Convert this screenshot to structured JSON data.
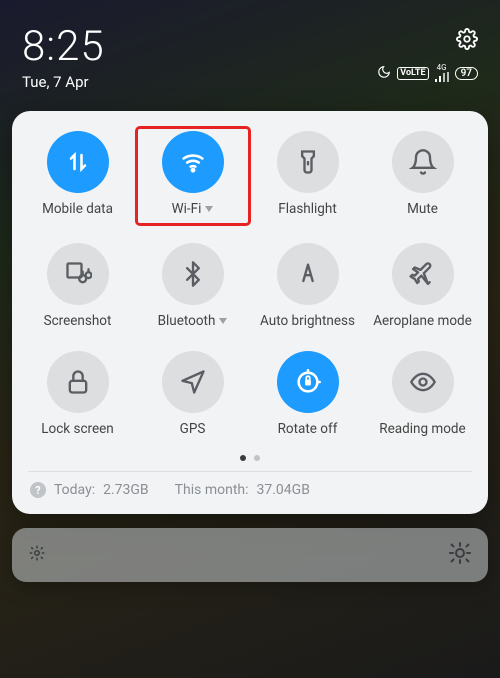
{
  "statusbar": {
    "time": "8:25",
    "date": "Tue, 7 Apr",
    "network_type": "4G",
    "volte": "VoLTE",
    "battery": "97"
  },
  "tiles": [
    {
      "label": "Mobile data",
      "active": true,
      "expandable": false
    },
    {
      "label": "Wi-Fi",
      "active": true,
      "expandable": true
    },
    {
      "label": "Flashlight",
      "active": false,
      "expandable": false
    },
    {
      "label": "Mute",
      "active": false,
      "expandable": false
    },
    {
      "label": "Screenshot",
      "active": false,
      "expandable": false
    },
    {
      "label": "Bluetooth",
      "active": false,
      "expandable": true
    },
    {
      "label": "Auto brightness",
      "active": false,
      "expandable": false
    },
    {
      "label": "Aeroplane mode",
      "active": false,
      "expandable": false
    },
    {
      "label": "Lock screen",
      "active": false,
      "expandable": false
    },
    {
      "label": "GPS",
      "active": false,
      "expandable": false
    },
    {
      "label": "Rotate off",
      "active": true,
      "expandable": false
    },
    {
      "label": "Reading mode",
      "active": false,
      "expandable": false
    }
  ],
  "data_usage": {
    "today_label": "Today:",
    "today_value": "2.73GB",
    "month_label": "This month:",
    "month_value": "37.04GB"
  }
}
